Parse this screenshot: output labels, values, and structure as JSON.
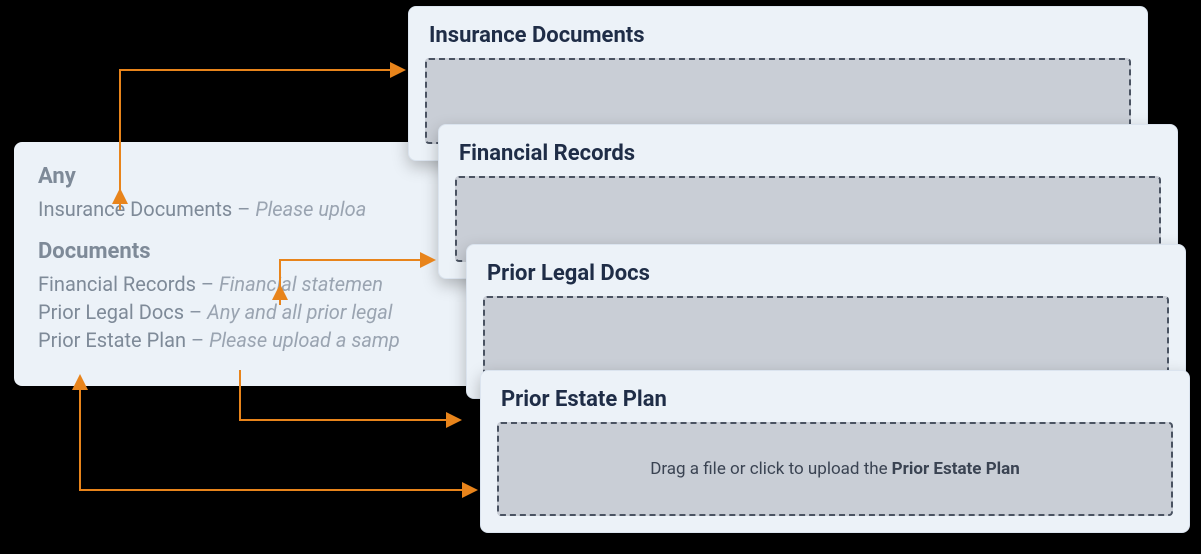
{
  "source": {
    "anyHeading": "Any",
    "anyItems": [
      {
        "label": "Insurance Documents",
        "desc": "Please uploa"
      }
    ],
    "documentsHeading": "Documents",
    "documentsItems": [
      {
        "label": "Financial Records",
        "desc": "Financial statemen"
      },
      {
        "label": "Prior Legal Docs",
        "desc": "Any and all prior legal"
      },
      {
        "label": "Prior Estate Plan",
        "desc": "Please upload a samp"
      }
    ]
  },
  "cards": [
    {
      "title": "Insurance Documents"
    },
    {
      "title": "Financial Records"
    },
    {
      "title": "Prior Legal Docs"
    },
    {
      "title": "Prior Estate Plan"
    }
  ],
  "dropzone": {
    "prefix": "Drag a file or click to upload the",
    "target": "Prior Estate Plan"
  }
}
